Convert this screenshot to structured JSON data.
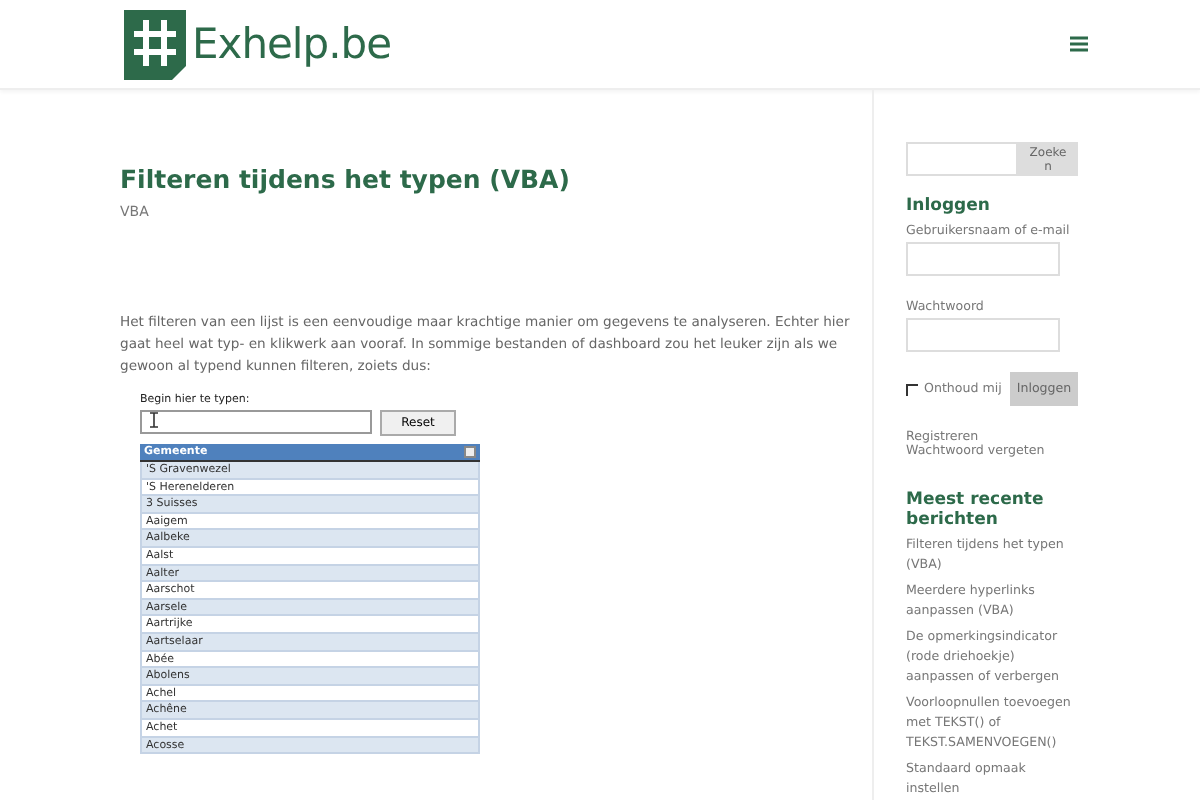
{
  "header": {
    "logo_text": "Exhelp.be"
  },
  "article": {
    "title": "Filteren tijdens het typen (VBA)",
    "category": "VBA",
    "paragraph": "Het filteren van een lijst is een eenvoudige maar krachtige manier om gegevens te analyseren. Echter hier gaat heel wat typ- en klikwerk aan vooraf. In sommige bestanden of dashboard zou het leuker zijn als we gewoon al typend kunnen filteren, zoiets dus:",
    "spreadsheet": {
      "input_label": "Begin hier te typen:",
      "reset_button": "Reset",
      "column_header": "Gemeente",
      "rows": [
        "'S Gravenwezel",
        "'S Herenelderen",
        "3 Suisses",
        "Aaigem",
        "Aalbeke",
        "Aalst",
        "Aalter",
        "Aarschot",
        "Aarsele",
        "Aartrijke",
        "Aartselaar",
        "Abée",
        "Abolens",
        "Achel",
        "Achêne",
        "Achet",
        "Acosse"
      ]
    }
  },
  "sidebar": {
    "search_button": "Zoeke n",
    "login": {
      "heading": "Inloggen",
      "username_label": "Gebruikersnaam of e-mail",
      "password_label": "Wachtwoord",
      "remember": {
        "label": "Onthoud mij",
        "checked": false
      },
      "submit": "Inloggen",
      "links": [
        "Registreren",
        "Wachtwoord vergeten"
      ]
    },
    "recent": {
      "heading": "Meest recente berichten",
      "posts": [
        "Filteren tijdens het typen (VBA)",
        "Meerdere hyperlinks aanpassen (VBA)",
        "De opmerkingsindicator (rode driehoekje) aanpassen of verbergen",
        "Voorloopnullen toevoegen met TEKST() of TEKST.SAMENVOEGEN()",
        "Standaard opmaak instellen"
      ]
    }
  }
}
